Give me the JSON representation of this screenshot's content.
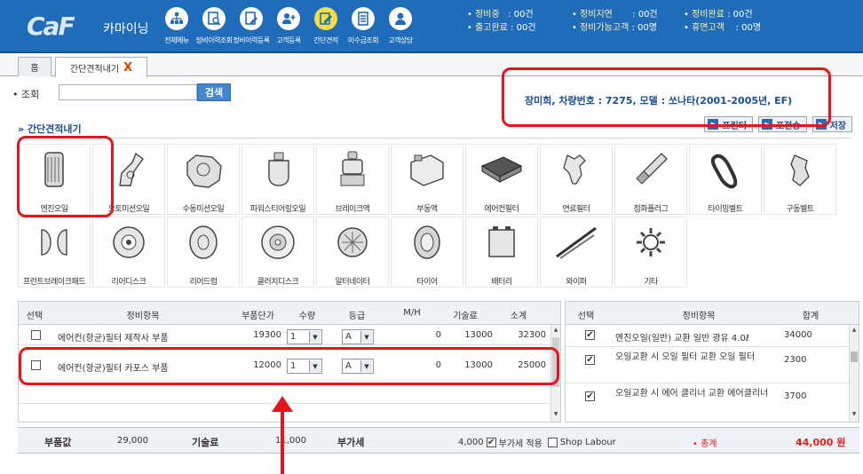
{
  "header": {
    "brand": "CaF",
    "brand_sub": "카마이닝",
    "menu": [
      {
        "label": "전체메뉴",
        "icon": "sitemap-icon"
      },
      {
        "label": "정비이력조회",
        "icon": "document-search-icon"
      },
      {
        "label": "정비이력등록",
        "icon": "document-edit-icon"
      },
      {
        "label": "고객등록",
        "icon": "add-user-icon"
      },
      {
        "label": "간단견적",
        "icon": "pencil-note-icon"
      },
      {
        "label": "미수금조회",
        "icon": "list-icon"
      },
      {
        "label": "고객상담",
        "icon": "consult-icon"
      }
    ],
    "status": [
      {
        "k": "정비중",
        "v": ": 00건"
      },
      {
        "k": "출고완료",
        "v": ": 00건"
      },
      {
        "k": "정비지연",
        "v": ": 00건"
      },
      {
        "k": "정비가능고객",
        "v": ": 00명"
      },
      {
        "k": "정비완료",
        "v": ": 00건"
      },
      {
        "k": "휴면고객",
        "v": ": 00명"
      }
    ]
  },
  "tabs": [
    {
      "label": "홈"
    },
    {
      "label": "간단견적내기",
      "close": "X"
    }
  ],
  "search": {
    "label": "조회",
    "button": "검색",
    "value": ""
  },
  "customer_info": "장미희, 차량번호 : 7275, 모델 : 쏘나타(2001-2005년, EF)",
  "section": {
    "title": "간단견적내기",
    "buttons": [
      "프린터",
      "포전송",
      "저장"
    ]
  },
  "parts": [
    "엔진오일",
    "오토미션오일",
    "수동미션오일",
    "파워스티어링오일",
    "브레이크액",
    "부동액",
    "에어컨필터",
    "연료필터",
    "점화플러그",
    "타이밍벨트",
    "구동벨트",
    "프런트브레이크패드",
    "리어디스크",
    "리어드럼",
    "클러치디스크",
    "알터네이터",
    "타이어",
    "배터리",
    "와이퍼",
    "기타"
  ],
  "left_table": {
    "headers": [
      "선택",
      "정비항목",
      "부품단가",
      "수량",
      "등급",
      "M/H",
      "기술료",
      "소계"
    ],
    "rows": [
      {
        "item": "에어컨(항균)필터 제작사 부품",
        "price": "19300",
        "qty": "1",
        "grade": "A",
        "mh": "0",
        "labor": "13000",
        "subtotal": "32300"
      },
      {
        "item": "에어컨(항균)필터 카포스 부품",
        "price": "12000",
        "qty": "1",
        "grade": "A",
        "mh": "0",
        "labor": "13000",
        "subtotal": "25000"
      }
    ]
  },
  "right_table": {
    "headers": [
      "선택",
      "정비항목",
      "합계"
    ],
    "rows": [
      {
        "checked": "✔",
        "item": "엔진오일(일반) 교환 일반 광유 4.0ℓ",
        "sum": "34000"
      },
      {
        "checked": "✔",
        "item": "오일교환 시 오일 필터 교환 오일 필터",
        "sum": "2300"
      },
      {
        "checked": "✔",
        "item": "오일교환 시 에어 클리너 교환 에어클리너",
        "sum": "3700"
      }
    ]
  },
  "totals": {
    "parts_label": "부품값",
    "parts_value": "29,000",
    "labor_label": "기술료",
    "labor_value": "11,000",
    "vat_label": "부가세",
    "vat_value": "4,000",
    "vat_apply": "부가세 적용",
    "shop_labour": "Shop Labour",
    "grand_label": "• 총계",
    "grand_value": "44,000 원"
  }
}
